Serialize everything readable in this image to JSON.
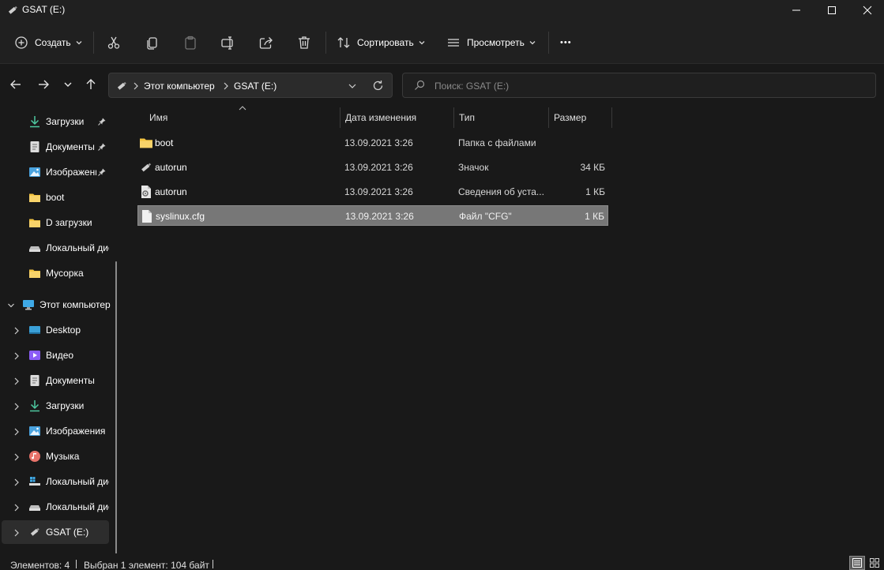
{
  "window": {
    "title": "GSAT (E:)"
  },
  "toolbar": {
    "new_label": "Создать",
    "sort_label": "Сортировать",
    "view_label": "Просмотреть",
    "more_label": "•••"
  },
  "address": {
    "crumbs": [
      "Этот компьютер",
      "GSAT (E:)"
    ]
  },
  "search": {
    "placeholder": "Поиск: GSAT (E:)"
  },
  "sidebar": {
    "items": [
      {
        "label": "Загрузки",
        "icon": "download-icon"
      },
      {
        "label": "Документы",
        "icon": "document-icon"
      },
      {
        "label": "Изображения",
        "icon": "pictures-icon"
      },
      {
        "label": "boot",
        "icon": "folder-icon"
      },
      {
        "label": "D загрузки",
        "icon": "folder-icon"
      },
      {
        "label": "Локальный диск",
        "icon": "drive-icon"
      },
      {
        "label": "Мусорка",
        "icon": "folder-icon"
      },
      {
        "label": "Этот компьютер",
        "icon": "computer-icon"
      },
      {
        "label": "Desktop",
        "icon": "desktop-icon"
      },
      {
        "label": "Видео",
        "icon": "video-icon"
      },
      {
        "label": "Документы",
        "icon": "document-icon"
      },
      {
        "label": "Загрузки",
        "icon": "download-icon"
      },
      {
        "label": "Изображения",
        "icon": "pictures-icon"
      },
      {
        "label": "Музыка",
        "icon": "music-icon"
      },
      {
        "label": "Локальный диск",
        "icon": "drive-icon"
      },
      {
        "label": "Локальный диск",
        "icon": "drive-icon"
      },
      {
        "label": "GSAT (E:)",
        "icon": "usb-drive-icon"
      }
    ]
  },
  "columns": {
    "name": "Имя",
    "date": "Дата изменения",
    "type": "Тип",
    "size": "Размер"
  },
  "files": [
    {
      "name": "boot",
      "date": "13.09.2021 3:26",
      "type": "Папка с файлами",
      "size": ""
    },
    {
      "name": "autorun",
      "date": "13.09.2021 3:26",
      "type": "Значок",
      "size": "34 КБ"
    },
    {
      "name": "autorun",
      "date": "13.09.2021 3:26",
      "type": "Сведения об уста...",
      "size": "1 КБ"
    },
    {
      "name": "syslinux.cfg",
      "date": "13.09.2021 3:26",
      "type": "Файл \"CFG\"",
      "size": "1 КБ"
    }
  ],
  "status": {
    "count": "Элементов: 4",
    "selection": "Выбран 1 элемент: 104 байт"
  },
  "colors": {
    "background": "#191919",
    "chrome": "#202020",
    "selection": "#777777",
    "folder": "#f4c542",
    "accent_green": "#4ec9a0",
    "accent_blue": "#4aa3df"
  }
}
